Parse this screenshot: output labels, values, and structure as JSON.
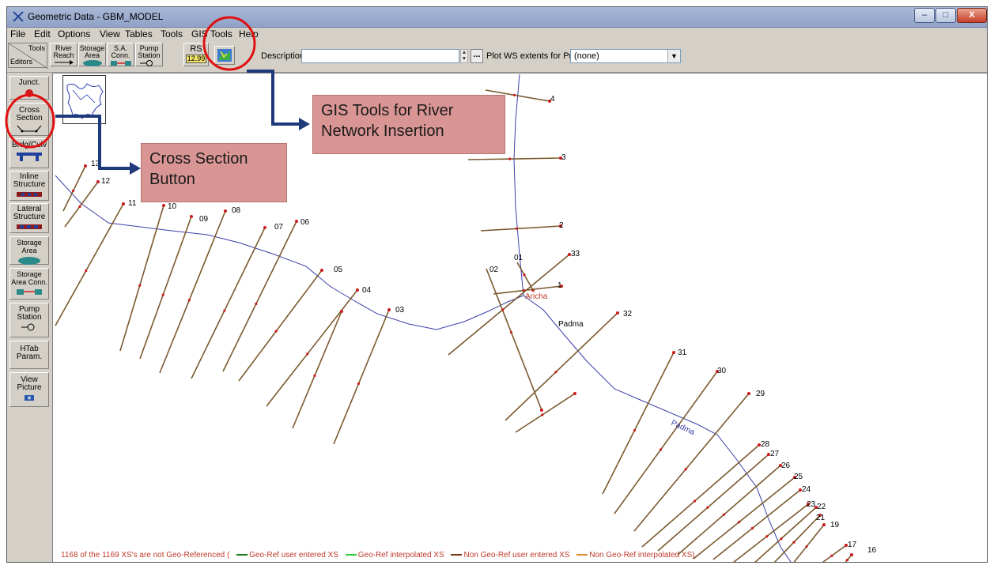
{
  "window": {
    "title": "Geometric Data - GBM_MODEL",
    "controls": [
      "–",
      "□",
      "X"
    ]
  },
  "menu": [
    "File",
    "Edit",
    "Options",
    "View",
    "Tables",
    "Tools",
    "GIS Tools",
    "Help"
  ],
  "toolbar": {
    "corner_top": "Tools",
    "corner_bottom": "Editors",
    "buttons": [
      {
        "line1": "River",
        "line2": "Reach"
      },
      {
        "line1": "Storage",
        "line2": "Area"
      },
      {
        "line1": "S.A.",
        "line2": "Conn."
      },
      {
        "line1": "Pump",
        "line2": "Station"
      }
    ],
    "rs_label": "RS",
    "rs_value": "12.99",
    "description_label": "Description :",
    "description_value": "",
    "ellipsis": "...",
    "plot_ws_label": "Plot WS extents for Profile:",
    "profile_value": "(none)"
  },
  "sidebar": [
    {
      "label": "Junct.",
      "icon": "junction-icon"
    },
    {
      "label": "Cross Section",
      "icon": "cross-section-icon"
    },
    {
      "label": "Brdg/Culv",
      "icon": "bridge-icon"
    },
    {
      "label": "Inline Structure",
      "icon": "inline-structure-icon"
    },
    {
      "label": "Lateral Structure",
      "icon": "lateral-structure-icon"
    },
    {
      "label": "Storage Area",
      "icon": "storage-area-icon"
    },
    {
      "label": "Storage Area Conn.",
      "icon": "storage-area-conn-icon"
    },
    {
      "label": "Pump Station",
      "icon": "pump-station-icon"
    },
    {
      "label": "HTab Param.",
      "icon": ""
    },
    {
      "label": "View Picture",
      "icon": "camera-icon"
    }
  ],
  "annotations": {
    "cross_section_callout": "Cross Section Button",
    "gis_callout": "GIS Tools for River Network Insertion"
  },
  "map": {
    "river_labels": [
      "Aricha",
      "Padma",
      "Padma"
    ],
    "xs_labels": [
      "13",
      "12",
      "11",
      "10",
      "09",
      "08",
      "07",
      "06",
      "05",
      "04",
      "03",
      "4",
      "3",
      "2",
      "01",
      "02",
      "1",
      "33",
      "32",
      "31",
      "30",
      "29",
      "28",
      "27",
      "26",
      "25",
      "24",
      "23",
      "22",
      "21",
      "19",
      "17",
      "16"
    ]
  },
  "status": {
    "text": "1168 of the 1169 XS's are not Geo-Referenced (",
    "legend": [
      {
        "label": "Geo-Ref user entered XS",
        "color": "#1a7a1a"
      },
      {
        "label": "Geo-Ref interpolated XS",
        "color": "#2ecc40"
      },
      {
        "label": "Non Geo-Ref user entered XS",
        "color": "#7a3a10"
      },
      {
        "label": "Non Geo-Ref interpolated XS)",
        "color": "#d98c30"
      }
    ]
  },
  "colors": {
    "xs_line": "#7a5a2e",
    "xs_point": "#cc1a1a",
    "river": "#3b3fa8",
    "highlight": "#e01010",
    "arrow": "#1f3a7a",
    "callout_bg": "#d99594"
  }
}
